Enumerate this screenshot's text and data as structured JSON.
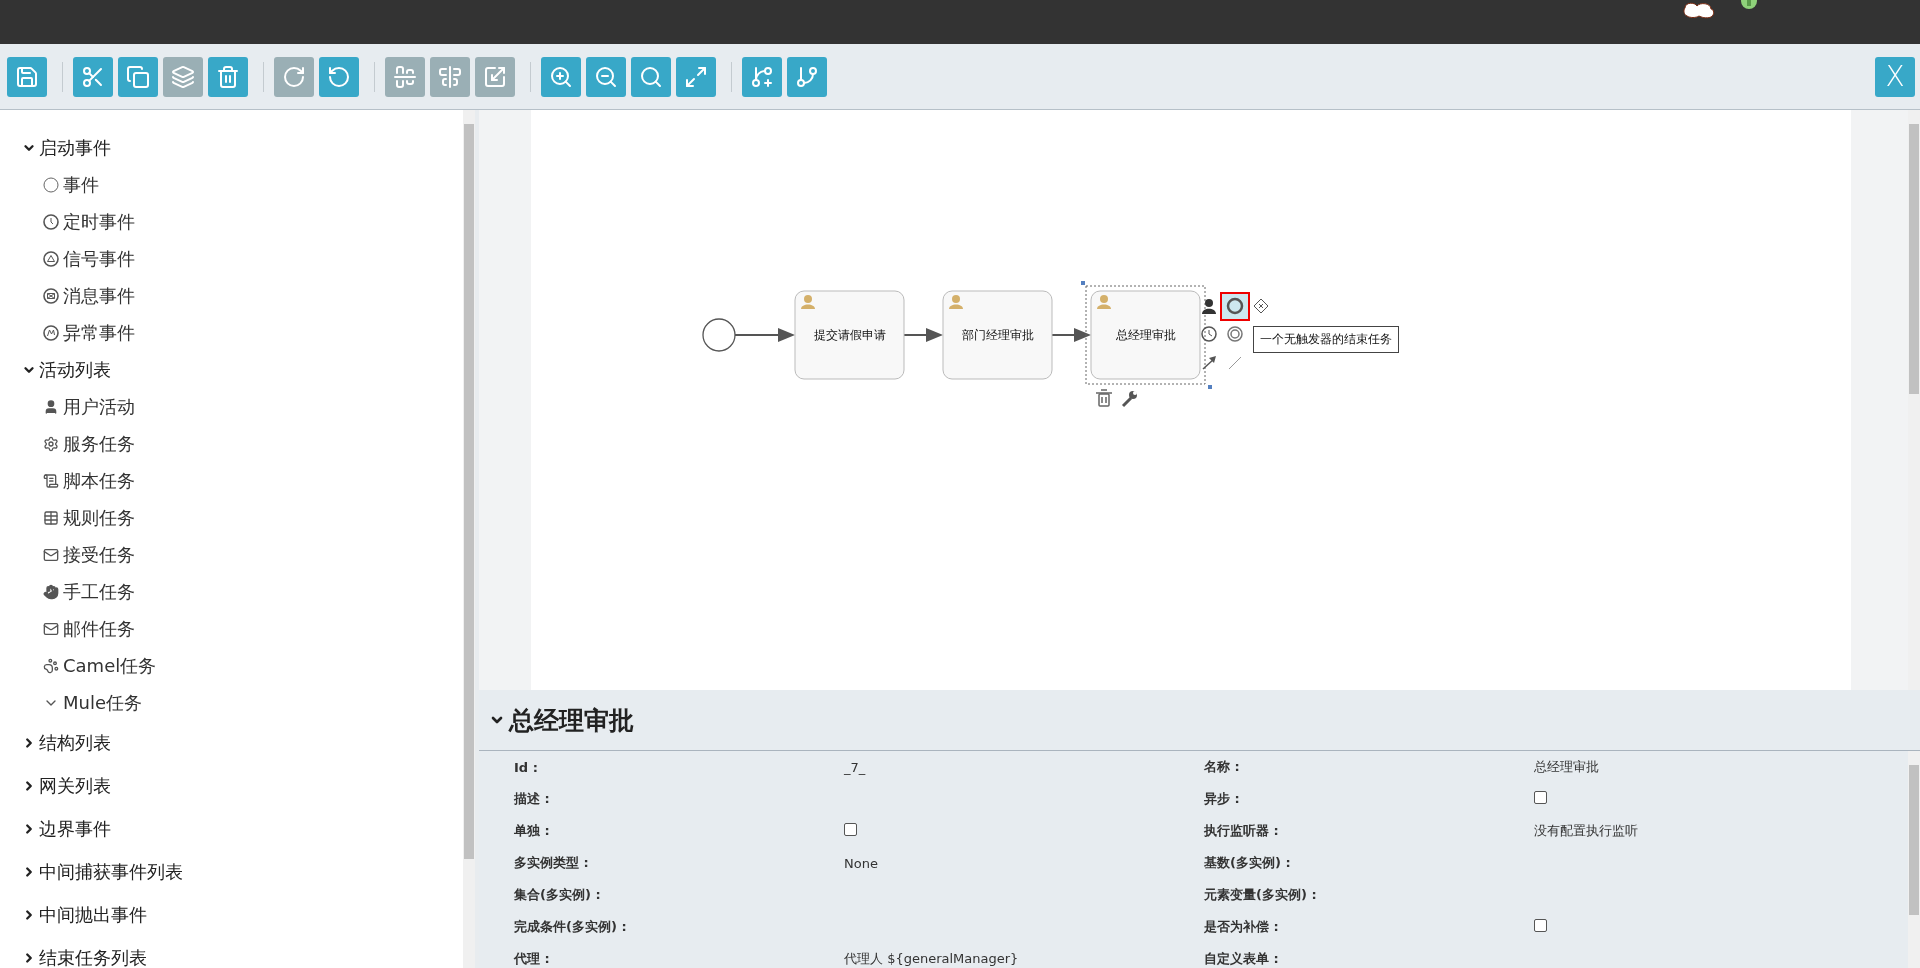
{
  "toolbar": {
    "groups": [
      [
        {
          "kind": "save",
          "disabled": false
        }
      ],
      [
        {
          "kind": "cut",
          "disabled": false
        },
        {
          "kind": "copy",
          "disabled": false
        },
        {
          "kind": "paste",
          "disabled": true
        },
        {
          "kind": "delete",
          "disabled": false
        }
      ],
      [
        {
          "kind": "redo",
          "disabled": true
        },
        {
          "kind": "undo",
          "disabled": false
        }
      ],
      [
        {
          "kind": "align-middle",
          "disabled": true
        },
        {
          "kind": "align-center",
          "disabled": true
        },
        {
          "kind": "same-size",
          "disabled": true
        }
      ],
      [
        {
          "kind": "zoom-in",
          "disabled": false
        },
        {
          "kind": "zoom-out",
          "disabled": false
        },
        {
          "kind": "zoom-reset",
          "disabled": false
        },
        {
          "kind": "zoom-fit",
          "disabled": false
        }
      ],
      [
        {
          "kind": "add-docker",
          "disabled": false
        },
        {
          "kind": "remove-docker",
          "disabled": false
        }
      ]
    ],
    "close_button": "X"
  },
  "palette": [
    {
      "label": "启动事件",
      "expanded": true,
      "children": [
        {
          "label": "事件",
          "kind": "none-event"
        },
        {
          "label": "定时事件",
          "kind": "timer-event"
        },
        {
          "label": "信号事件",
          "kind": "signal-event"
        },
        {
          "label": "消息事件",
          "kind": "message-event"
        },
        {
          "label": "异常事件",
          "kind": "error-event"
        }
      ]
    },
    {
      "label": "活动列表",
      "expanded": true,
      "children": [
        {
          "label": "用户活动",
          "kind": "user"
        },
        {
          "label": "服务任务",
          "kind": "service"
        },
        {
          "label": "脚本任务",
          "kind": "script"
        },
        {
          "label": "规则任务",
          "kind": "rule"
        },
        {
          "label": "接受任务",
          "kind": "receive"
        },
        {
          "label": "手工任务",
          "kind": "manual"
        },
        {
          "label": "邮件任务",
          "kind": "mail"
        },
        {
          "label": "Camel任务",
          "kind": "camel"
        },
        {
          "label": "Mule任务",
          "kind": "mule"
        }
      ]
    },
    {
      "label": "结构列表",
      "expanded": false
    },
    {
      "label": "网关列表",
      "expanded": false
    },
    {
      "label": "边界事件",
      "expanded": false
    },
    {
      "label": "中间捕获事件列表",
      "expanded": false
    },
    {
      "label": "中间抛出事件",
      "expanded": false
    },
    {
      "label": "结束任务列表",
      "expanded": false
    }
  ],
  "diagram": {
    "nodes": [
      {
        "kind": "start-event"
      },
      {
        "kind": "user-task",
        "label": "提交请假申请",
        "selected": false
      },
      {
        "kind": "user-task",
        "label": "部门经理审批",
        "selected": false
      },
      {
        "kind": "user-task",
        "label": "总经理审批",
        "selected": true
      }
    ],
    "tooltip": "一个无触发器的结束任务"
  },
  "properties": {
    "title": "总经理审批",
    "expanded": true,
    "rows": [
      [
        {
          "label": "Id :",
          "kind": "text",
          "value": "_7_"
        },
        {
          "label": "名称 :",
          "kind": "text",
          "value": "总经理审批"
        }
      ],
      [
        {
          "label": "描述 :",
          "kind": "text"
        },
        {
          "label": "异步 :",
          "kind": "checkbox",
          "checked": false
        }
      ],
      [
        {
          "label": "单独 :",
          "kind": "checkbox",
          "checked": false
        },
        {
          "label": "执行监听器 :",
          "kind": "text",
          "value": "没有配置执行监听"
        }
      ],
      [
        {
          "label": "多实例类型 :",
          "kind": "text",
          "value": "None"
        },
        {
          "label": "基数(多实例) :",
          "kind": "text"
        }
      ],
      [
        {
          "label": "集合(多实例) :",
          "kind": "text"
        },
        {
          "label": "元素变量(多实例) :",
          "kind": "text"
        }
      ],
      [
        {
          "label": "完成条件(多实例) :",
          "kind": "text"
        },
        {
          "label": "是否为补偿 :",
          "kind": "checkbox",
          "checked": false
        }
      ],
      [
        {
          "label": "代理 :",
          "kind": "text",
          "value": "代理人 ${generalManager}"
        },
        {
          "label": "自定义表单 :",
          "kind": "text"
        }
      ]
    ]
  }
}
